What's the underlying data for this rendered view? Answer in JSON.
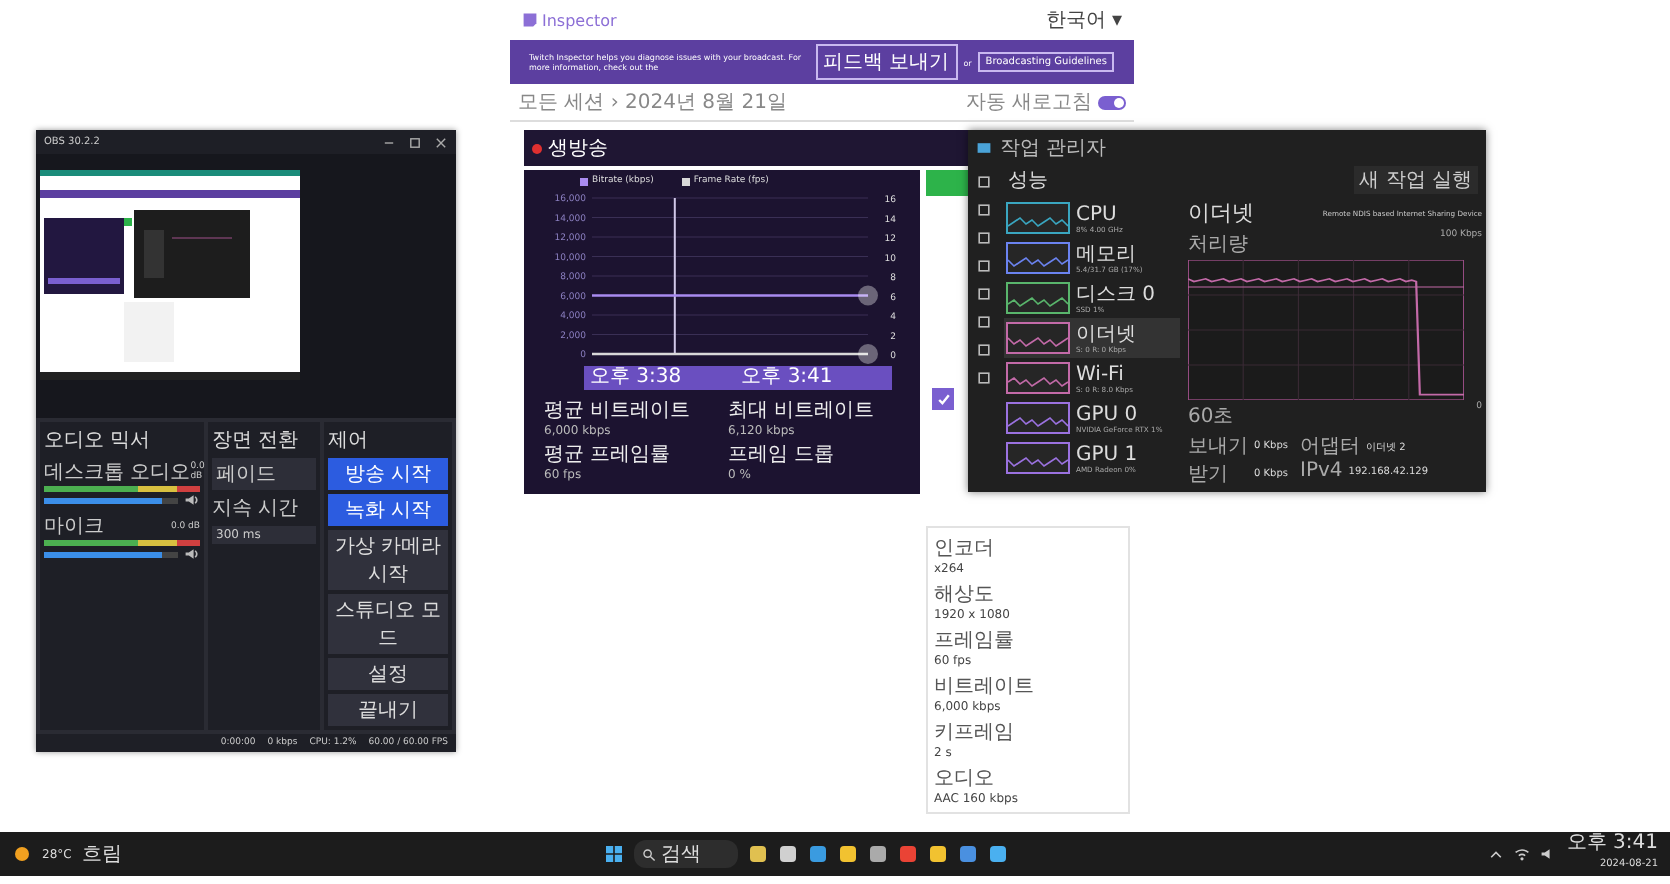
{
  "web": {
    "logo": "Inspector",
    "language": "한국어 ▾",
    "banner": {
      "text": "Twitch Inspector helps you diagnose issues with your broadcast. For more information, check out the",
      "feedback": "피드백 보내기",
      "or": "or",
      "guidelines": "Broadcasting Guidelines"
    },
    "breadcrumb": "모든 세션 › 2024년 8월 21일",
    "auto_refresh": {
      "label": "자동 새로고침",
      "on": true
    },
    "stream": {
      "status": "생방송",
      "live": true
    },
    "chart_panel": {
      "chart_data": {
        "type": "line",
        "grid": true,
        "categories": [
          null,
          null,
          null,
          null,
          null,
          null,
          null,
          null,
          null,
          null,
          null
        ],
        "ylim": [
          0,
          16000
        ],
        "yticks": [
          0,
          {
            "value": 2000,
            "label": "2,000"
          },
          {
            "value": 4000,
            "label": "4,000"
          },
          {
            "value": 6000,
            "label": "6,000"
          },
          {
            "value": 8000,
            "label": "8,000"
          },
          {
            "value": 10000,
            "label": "10,000"
          },
          {
            "value": 12000,
            "label": "12,000"
          },
          {
            "value": 14000,
            "label": "14,000"
          },
          {
            "value": 16000,
            "label": "16,000"
          }
        ],
        "series": [
          {
            "name": "Bitrate (kbps)",
            "color": "#a98bf0",
            "values": [
              6000,
              6000,
              6000,
              6000,
              6000,
              6000,
              6000,
              6000,
              6000,
              6000,
              6000
            ]
          },
          {
            "name": "Frame Rate (fps)",
            "color": "#d8d8d8",
            "values": [
              0,
              0,
              0,
              0,
              0,
              0,
              0,
              0,
              0,
              0,
              0
            ]
          }
        ]
      },
      "right_axis": [
        "16",
        "14",
        "12",
        "10",
        "8",
        "6",
        "4",
        "2",
        "0"
      ],
      "event_marker": true,
      "range": {
        "start": "오후 3:38",
        "end": "오후 3:41",
        "level": 1
      },
      "stats": [
        {
          "label": "평균 비트레이트",
          "value": "6,000 kbps"
        },
        {
          "label": "최대 비트레이트",
          "value": "6,120 kbps"
        },
        {
          "label": "평균 프레임률",
          "value": "60 fps"
        },
        {
          "label": "프레임 드롭",
          "value": "0 %"
        }
      ]
    },
    "side": {
      "button": {
        "kind": "primary"
      },
      "check": {
        "checked": true
      },
      "fields": [
        {
          "label": "인코더",
          "value": "x264"
        },
        {
          "label": "해상도",
          "value": "1920 x 1080"
        },
        {
          "label": "프레임률",
          "value": "60 fps"
        },
        {
          "label": "비트레이트",
          "value": "6,000 kbps"
        },
        {
          "label": "키프레임",
          "value": "2 s"
        },
        {
          "label": "오디오",
          "value": "AAC 160 kbps"
        }
      ]
    }
  },
  "obs": {
    "title": "OBS 30.2.2",
    "mixer": {
      "title": "오디오 믹서",
      "channels": [
        {
          "name": "데스크톱 오디오",
          "reading": "0.0 dB",
          "level": 0.88,
          "muted": false
        },
        {
          "name": "마이크",
          "reading": "0.0 dB",
          "level": 0.88,
          "muted": false
        }
      ]
    },
    "transition": {
      "title": "장면 전환",
      "type": "페이드",
      "duration_label": "지속 시간",
      "duration": "300 ms"
    },
    "controls": {
      "title": "제어",
      "buttons": [
        {
          "label": "방송 시작",
          "kind": "primary"
        },
        {
          "label": "녹화 시작",
          "kind": "primary"
        },
        {
          "label": "가상 카메라 시작",
          "kind": "normal"
        },
        {
          "label": "스튜디오 모드",
          "kind": "normal"
        },
        {
          "label": "설정",
          "kind": "normal"
        },
        {
          "label": "끝내기",
          "kind": "normal"
        }
      ]
    },
    "status": [
      "0:00:00",
      "0 kbps",
      "CPU: 1.2%",
      "60.00 / 60.00 FPS"
    ]
  },
  "task_manager": {
    "title": "작업 관리자",
    "section": "성능",
    "run_task": "새 작업 실행",
    "items": [
      {
        "name": "CPU",
        "detail": "8% 4.00 GHz",
        "color": "#3aa6c0",
        "selected": false
      },
      {
        "name": "메모리",
        "detail": "5.4/31.7 GB (17%)",
        "color": "#6b83f0",
        "selected": false
      },
      {
        "name": "디스크 0",
        "detail": "SSD 1%",
        "color": "#59b56c",
        "selected": false
      },
      {
        "name": "이더넷",
        "detail": "S: 0 R: 0 Kbps",
        "color": "#c36aa8",
        "selected": true
      },
      {
        "name": "Wi-Fi",
        "detail": "S: 0 R: 8.0 Kbps",
        "color": "#c36aa8",
        "selected": false
      },
      {
        "name": "GPU 0",
        "detail": "NVIDIA GeForce RTX 1%",
        "color": "#9b72e0",
        "selected": false
      },
      {
        "name": "GPU 1",
        "detail": "AMD Radeon 0%",
        "color": "#9b72e0",
        "selected": false
      }
    ],
    "heading": "이더넷",
    "device": "Remote NDIS based Internet Sharing Device",
    "graph_label": "처리량",
    "graph_max": "100 Kbps",
    "graph_time": "60초",
    "graph_min": "0",
    "send": {
      "label": "보내기",
      "value": "0 Kbps"
    },
    "receive": {
      "label": "받기",
      "value": "0 Kbps"
    },
    "details": [
      {
        "label": "어댑터",
        "value": "이더넷 2"
      },
      {
        "label": "IPv4",
        "value": "192.168.42.129"
      }
    ]
  },
  "taskbar": {
    "weather": "28°C",
    "weather_text": "흐림",
    "search": "검색",
    "time": "오후 3:41",
    "date": "2024-08-21"
  }
}
